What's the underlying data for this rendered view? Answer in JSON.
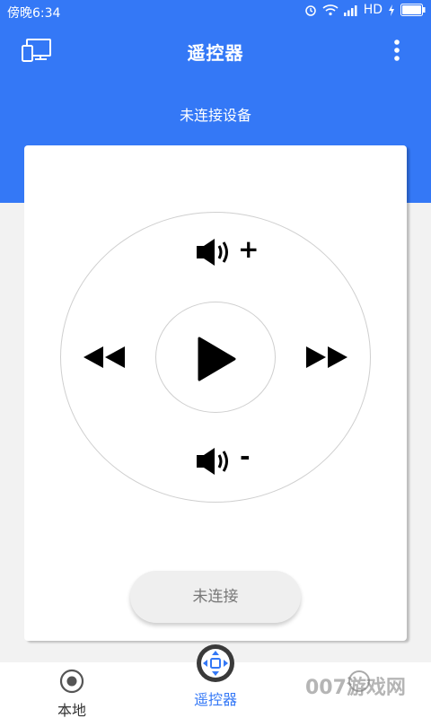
{
  "status_bar": {
    "time": "傍晚6:34",
    "network": "HD"
  },
  "app_bar": {
    "title": "遥控器"
  },
  "subtitle": "未连接设备",
  "remote": {
    "volume_up_sign": "+",
    "volume_down_sign": "-",
    "connect_button_label": "未连接"
  },
  "bottom_nav": {
    "items": [
      {
        "label": "本地",
        "icon": "record-icon"
      },
      {
        "label": "遥控器",
        "icon": "dpad-icon",
        "active": true
      },
      {
        "label": "",
        "icon": "unknown-icon"
      }
    ]
  },
  "watermark": "007游戏网",
  "colors": {
    "primary": "#3478f6",
    "background": "#f2f2f2",
    "card": "#ffffff"
  }
}
